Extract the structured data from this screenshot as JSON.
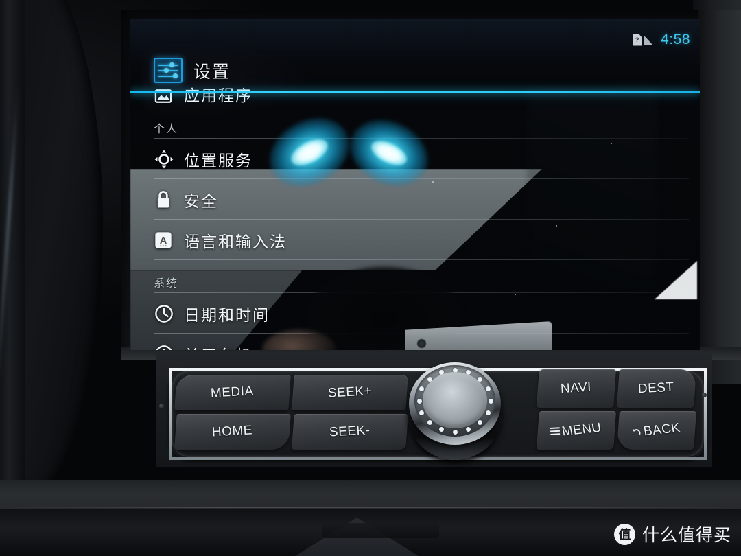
{
  "status_bar": {
    "time": "4:58",
    "sim_icon": "sim-card-icon",
    "sim_glyph": "?",
    "signal_icon": "signal-icon",
    "time_color": "#3fc9f0"
  },
  "header": {
    "title": "设置",
    "icon": "settings-sliders-icon",
    "divider_color": "#2fcbf6"
  },
  "list": {
    "clipped_item": {
      "label": "应用程序",
      "icon": "apps-image-icon"
    },
    "sections": [
      {
        "title": "个人",
        "items": [
          {
            "label": "位置服务",
            "icon": "location-crosshair-icon"
          },
          {
            "label": "安全",
            "icon": "lock-icon"
          },
          {
            "label": "语言和输入法",
            "icon": "language-a-icon"
          }
        ]
      },
      {
        "title": "系统",
        "items": [
          {
            "label": "日期和时间",
            "icon": "clock-icon"
          },
          {
            "label": "关于车机",
            "icon": "info-circle-icon"
          }
        ]
      }
    ]
  },
  "control_panel": {
    "left_buttons": [
      {
        "label": "MEDIA",
        "icon": ""
      },
      {
        "label": "SEEK+",
        "icon": ""
      },
      {
        "label": "HOME",
        "icon": ""
      },
      {
        "label": "SEEK-",
        "icon": ""
      }
    ],
    "right_buttons": [
      {
        "label": "NAVI",
        "icon": ""
      },
      {
        "label": "DEST",
        "icon": ""
      },
      {
        "label": "MENU",
        "icon": "hamburger-menu-icon"
      },
      {
        "label": "BACK",
        "icon": "back-arrow-icon"
      }
    ],
    "knob": {
      "name": "rotary-control-knob",
      "dot_count": 16
    }
  },
  "watermark": {
    "badge": "值",
    "text": "什么值得买"
  }
}
